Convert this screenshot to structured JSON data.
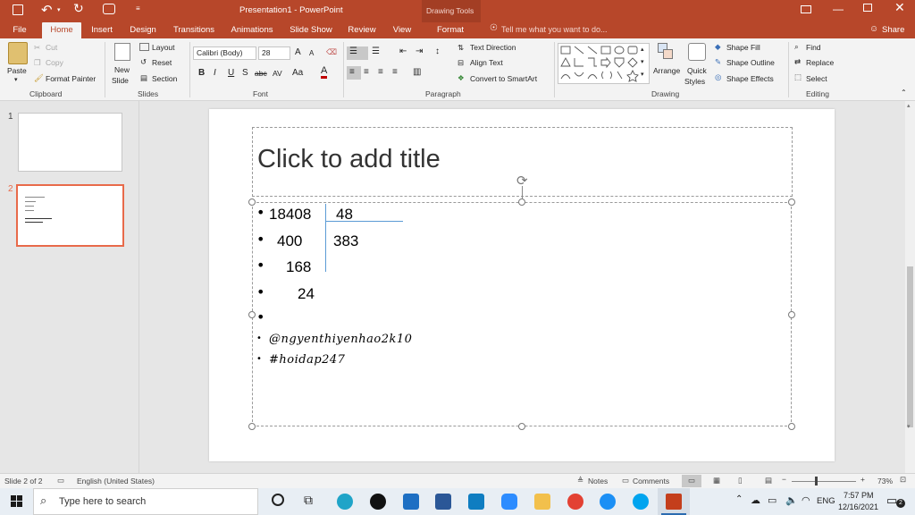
{
  "window": {
    "title": "Presentation1 - PowerPoint",
    "contextual_tab_group": "Drawing Tools",
    "tell_me": "Tell me what you want to do...",
    "share": "Share"
  },
  "tabs": [
    "File",
    "Home",
    "Insert",
    "Design",
    "Transitions",
    "Animations",
    "Slide Show",
    "Review",
    "View",
    "Format"
  ],
  "active_tab": "Home",
  "ribbon": {
    "clipboard": {
      "label": "Clipboard",
      "paste": "Paste",
      "cut": "Cut",
      "copy": "Copy",
      "format_painter": "Format Painter"
    },
    "slides": {
      "label": "Slides",
      "new_slide_line1": "New",
      "new_slide_line2": "Slide",
      "layout": "Layout",
      "reset": "Reset",
      "section": "Section"
    },
    "font": {
      "label": "Font",
      "font_name": "Calibri (Body)",
      "font_size": "28",
      "bold": "B",
      "italic": "I",
      "underline": "U",
      "shadow": "S",
      "strike": "abc",
      "spacing": "AV",
      "case": "Aa"
    },
    "paragraph": {
      "label": "Paragraph",
      "text_direction": "Text Direction",
      "align_text": "Align Text",
      "convert_smartart": "Convert to SmartArt"
    },
    "drawing": {
      "label": "Drawing",
      "arrange": "Arrange",
      "quick_styles_line1": "Quick",
      "quick_styles_line2": "Styles",
      "shape_fill": "Shape Fill",
      "shape_outline": "Shape Outline",
      "shape_effects": "Shape Effects"
    },
    "editing": {
      "label": "Editing",
      "find": "Find",
      "replace": "Replace",
      "select": "Select"
    }
  },
  "thumbnails": [
    {
      "number": "1"
    },
    {
      "number": "2"
    }
  ],
  "slide": {
    "title_placeholder": "Click to add title",
    "division": {
      "dividend": "18408",
      "divisor": "48",
      "quotient": "383",
      "steps": [
        "400",
        "168",
        "24"
      ]
    },
    "handwritten": [
      "@ngyenthiyenhao2k10",
      "#hoidap247"
    ]
  },
  "status": {
    "slide_info": "Slide 2 of 2",
    "language": "English (United States)",
    "notes": "Notes",
    "comments": "Comments",
    "zoom": "73%"
  },
  "taskbar": {
    "search_placeholder": "Type here to search",
    "language": "ENG",
    "time": "7:57 PM",
    "date": "12/16/2021",
    "notification_count": "2"
  },
  "colors": {
    "accent": "#b7472a",
    "selected_thumb": "#e86a4a"
  }
}
